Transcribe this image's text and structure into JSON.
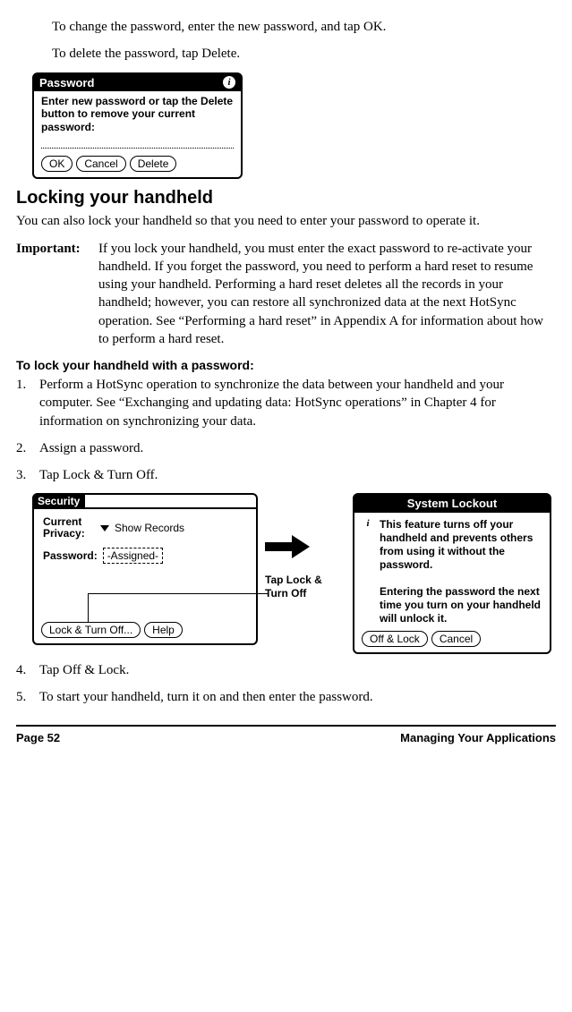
{
  "intro": {
    "change_line": "To change the password, enter the new password, and tap OK.",
    "delete_line": "To delete the password, tap Delete."
  },
  "password_dialog": {
    "title": "Password",
    "message": "Enter new password or tap the Delete button to remove your current password:",
    "buttons": {
      "ok": "OK",
      "cancel": "Cancel",
      "delete": "Delete"
    }
  },
  "section": {
    "heading": "Locking your handheld",
    "intro": "You can also lock your handheld so that you need to enter your password to operate it.",
    "important_label": "Important:",
    "important_text": "If you lock your handheld, you must enter the exact password to re-activate your handheld. If you forget the password, you need to perform a hard reset to resume using your handheld. Performing a hard reset deletes all the records in your handheld; however, you can restore all synchronized data at the next HotSync operation. See “Performing a hard reset” in Appendix A for information about how to perform a hard reset."
  },
  "procedure": {
    "heading": "To lock your handheld with a password:",
    "steps": [
      "Perform a HotSync operation to synchronize the data between your handheld and your computer. See “Exchanging and updating data: HotSync operations” in Chapter 4 for information on synchronizing your data.",
      "Assign a password.",
      "Tap Lock & Turn Off.",
      "Tap Off & Lock.",
      "To start your handheld, turn it on and then enter the password."
    ]
  },
  "security_dialog": {
    "title": "Security",
    "privacy_label": "Current Privacy:",
    "privacy_value": "Show Records",
    "password_label": "Password:",
    "password_value": "-Assigned-",
    "lock_button": "Lock & Turn Off...",
    "help_button": "Help"
  },
  "callout": {
    "label": "Tap Lock & Turn Off"
  },
  "lockout_dialog": {
    "title": "System Lockout",
    "message": "This feature turns off your handheld and prevents others from using it without the password.\n\nEntering the password the next time you turn on your handheld will unlock it.",
    "off_lock": "Off & Lock",
    "cancel": "Cancel"
  },
  "footer": {
    "page": "Page 52",
    "chapter": "Managing Your Applications"
  }
}
